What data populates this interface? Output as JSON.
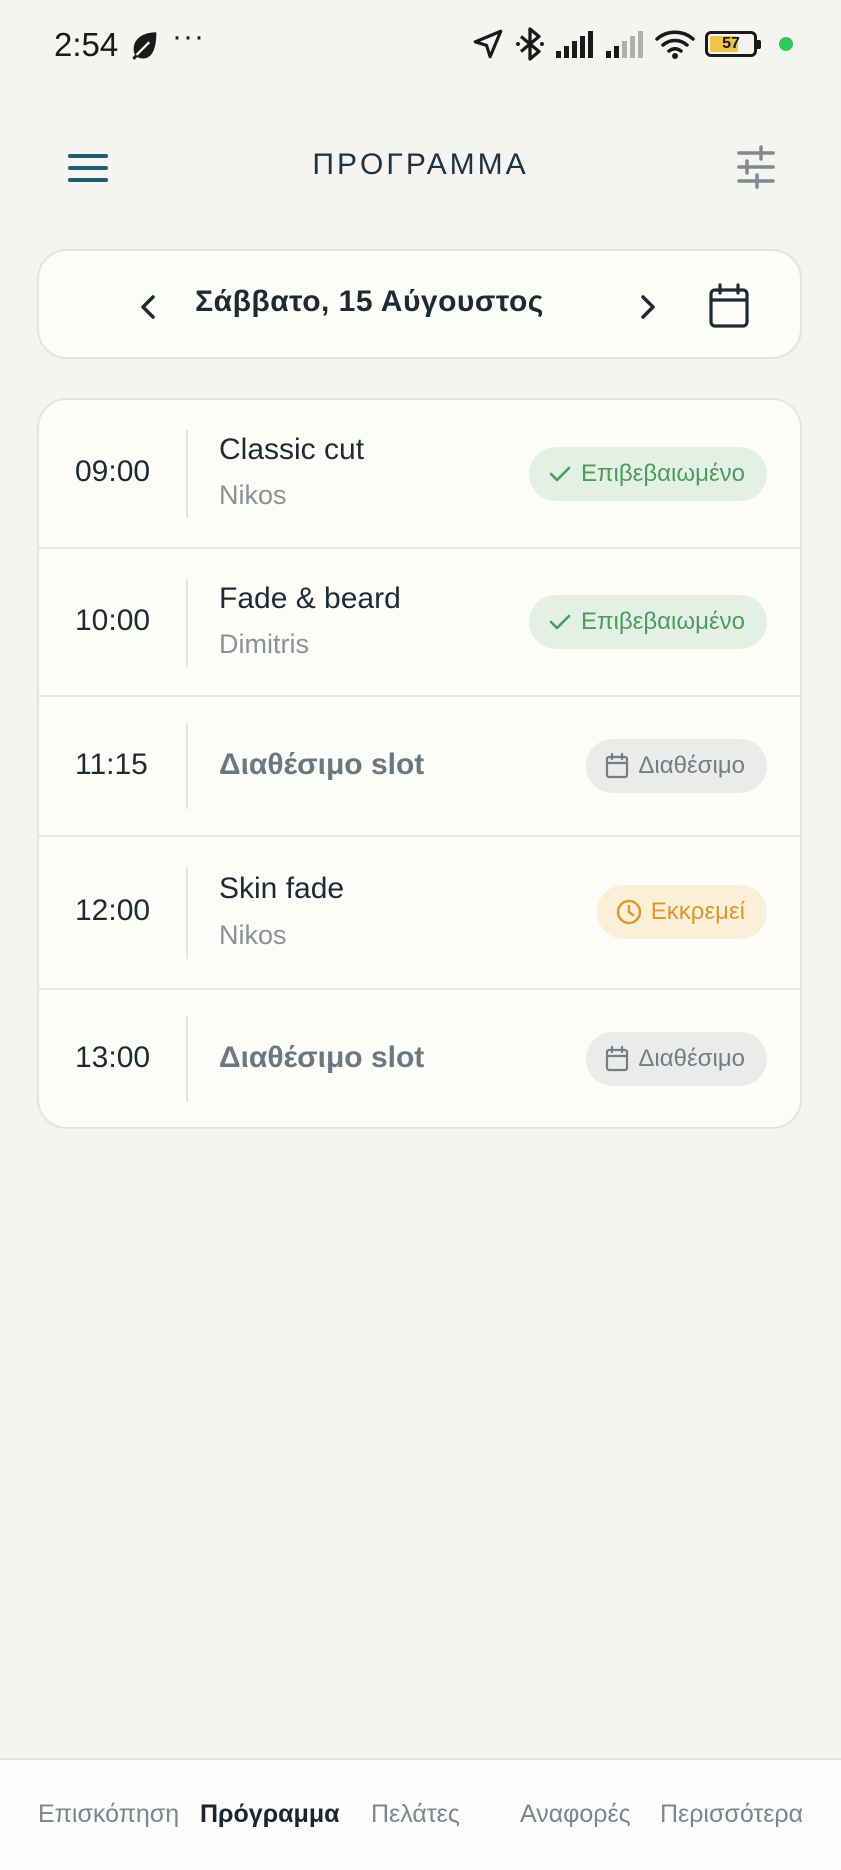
{
  "status_bar": {
    "time": "2:54",
    "dots": "···",
    "battery": "57",
    "icons": [
      "leaf-icon",
      "location-arrow-icon",
      "bluetooth-icon",
      "signal-icon",
      "signal-weak-icon",
      "wifi-icon",
      "battery-icon"
    ]
  },
  "header": {
    "title": "ΠΡΟΓΡΑΜΜΑ",
    "menu_icon": "hamburger-menu-icon",
    "filter_icon": "sliders-icon"
  },
  "date_nav": {
    "label": "Σάββατο, 15 Αύγουστος"
  },
  "appointments": [
    {
      "time": "09:00",
      "title": "Classic cut",
      "barber": "Nikos",
      "status": "Επιβεβαιωμένο",
      "status_type": "confirmed"
    },
    {
      "time": "10:00",
      "title": "Fade & beard",
      "barber": "Dimitris",
      "status": "Επιβεβαιωμένο",
      "status_type": "confirmed"
    },
    {
      "time": "11:15",
      "title": "Διαθέσιμο slot",
      "barber": "",
      "status": "Διαθέσιμο",
      "status_type": "available"
    },
    {
      "time": "12:00",
      "title": "Skin fade",
      "barber": "Nikos",
      "status": "Εκκρεμεί",
      "status_type": "pending"
    },
    {
      "time": "13:00",
      "title": "Διαθέσιμο slot",
      "barber": "",
      "status": "Διαθέσιμο",
      "status_type": "available"
    }
  ],
  "bottom_nav": {
    "items": [
      "Επισκόπηση",
      "Πρόγραμμα",
      "Πελάτες",
      "Αναφορές",
      "Περισσότερα"
    ],
    "active": "Πρόγραμμα"
  },
  "colors": {
    "accent": "#1d5c70",
    "confirmed_bg": "#e3f1e4",
    "confirmed_fg": "#4e9a5e",
    "pending_bg": "#fcefd8",
    "pending_fg": "#d89a2e",
    "available_bg": "#ebebea",
    "available_fg": "#747c84"
  }
}
